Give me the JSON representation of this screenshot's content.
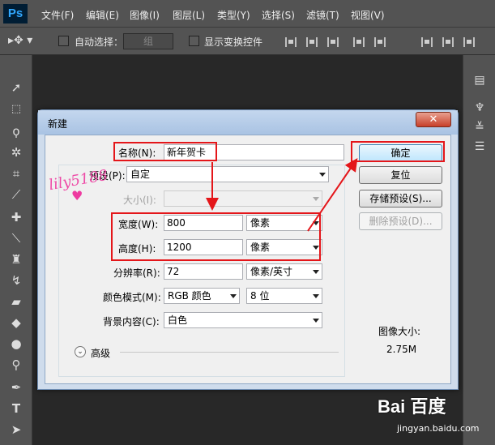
{
  "app": {
    "logo": "Ps"
  },
  "menubar": {
    "items": [
      "文件(F)",
      "编辑(E)",
      "图像(I)",
      "图层(L)",
      "类型(Y)",
      "选择(S)",
      "滤镜(T)",
      "视图(V)"
    ]
  },
  "options": {
    "auto_select_label": "自动选择：",
    "auto_select_value": "组",
    "transform_label": "显示变换控件"
  },
  "dialog": {
    "title": "新建",
    "close": "✕",
    "name_label": "名称(N):",
    "name_value": "新年贺卡",
    "preset_label": "预设(P):",
    "preset_value": "自定",
    "size_label": "大小(I):",
    "width_label": "宽度(W):",
    "width_value": "800",
    "width_unit": "像素",
    "height_label": "高度(H):",
    "height_value": "1200",
    "height_unit": "像素",
    "resolution_label": "分辨率(R):",
    "resolution_value": "72",
    "resolution_unit": "像素/英寸",
    "color_mode_label": "颜色模式(M):",
    "color_mode_value": "RGB 颜色",
    "bit_depth_value": "8 位",
    "background_label": "背景内容(C):",
    "background_value": "白色",
    "advanced_label": "高级",
    "ok_button": "确定",
    "reset_button": "复位",
    "save_preset_button": "存储预设(S)...",
    "delete_preset_button": "删除预设(D)...",
    "image_size_label": "图像大小:",
    "image_size_value": "2.75M"
  },
  "watermark": {
    "text": "lily5188"
  },
  "footer": {
    "brand": "Bai  百度",
    "url": "jingyan.baidu.com"
  },
  "colors": {
    "highlight": "#e4161a",
    "watermark": "#ee3aa0"
  },
  "icons": [
    "move-tool-icon",
    "marquee-tool-icon",
    "lasso-tool-icon",
    "magic-wand-icon",
    "crop-tool-icon",
    "eyedropper-icon",
    "healing-brush-icon",
    "brush-tool-icon",
    "stamp-tool-icon",
    "history-brush-icon",
    "eraser-icon",
    "paint-bucket-icon",
    "blur-tool-icon",
    "dodge-tool-icon",
    "pen-tool-icon",
    "type-tool-icon",
    "path-select-icon"
  ]
}
